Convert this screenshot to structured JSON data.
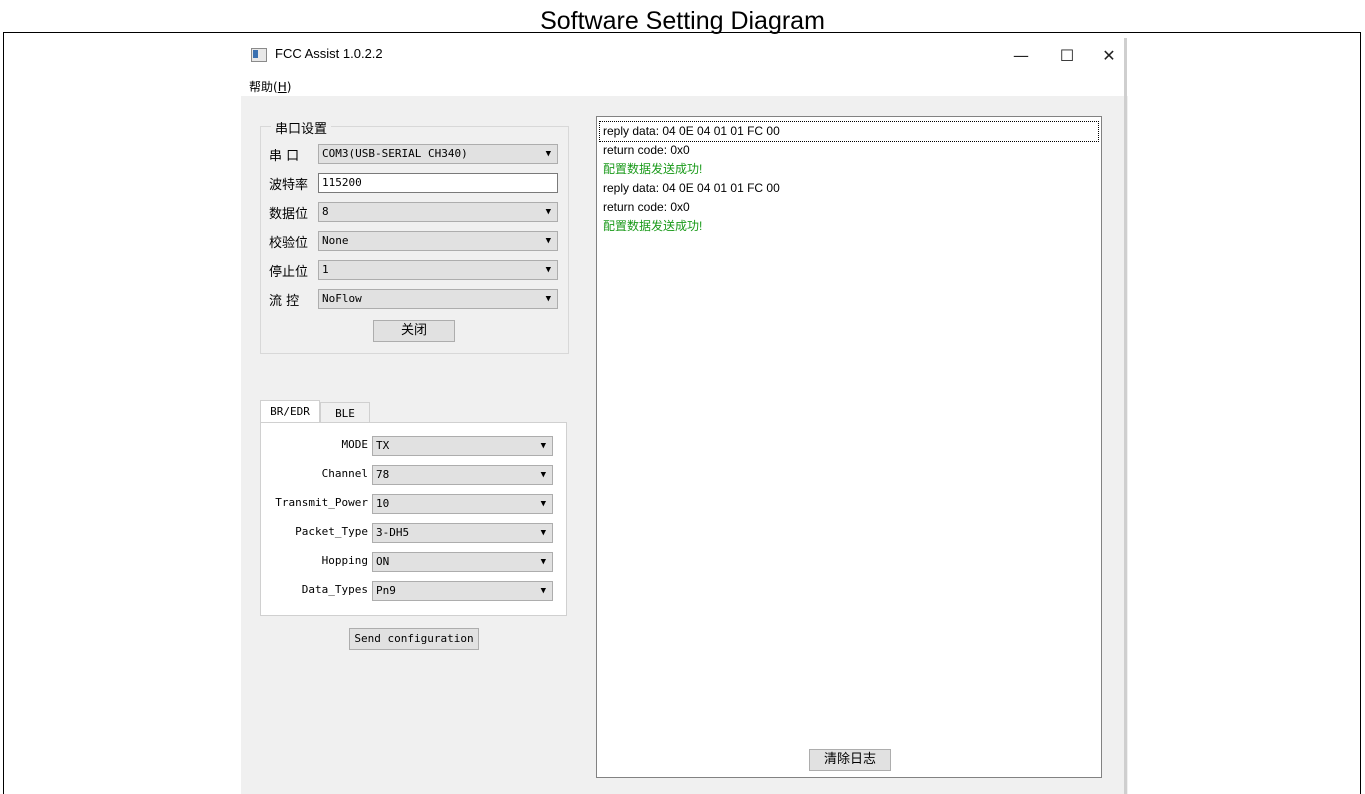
{
  "figure": {
    "title": "Software Setting Diagram"
  },
  "window": {
    "title": "FCC Assist 1.0.2.2",
    "controls": {
      "minimize": "—",
      "maximize": "☐",
      "close": "✕"
    },
    "menu": {
      "help_label": "帮助(",
      "help_key": "H",
      "help_close": ")"
    }
  },
  "serial": {
    "group_title": "串口设置",
    "port_label": "串 口",
    "port_value": "COM3(USB-SERIAL CH340)",
    "baud_label": "波特率",
    "baud_value": "115200",
    "databits_label": "数据位",
    "databits_value": "8",
    "parity_label": "校验位",
    "parity_value": "None",
    "stopbits_label": "停止位",
    "stopbits_value": "1",
    "flow_label": "流 控",
    "flow_value": "NoFlow",
    "toggle_button": "关闭"
  },
  "tabs": {
    "br_edr": "BR/EDR",
    "ble": "BLE"
  },
  "params": {
    "mode_label": "MODE",
    "mode_value": "TX",
    "channel_label": "Channel",
    "channel_value": "78",
    "power_label": "Transmit_Power",
    "power_value": "10",
    "packet_label": "Packet_Type",
    "packet_value": "3-DH5",
    "hopping_label": "Hopping",
    "hopping_value": "ON",
    "datatype_label": "Data_Types",
    "datatype_value": "Pn9"
  },
  "send_button": "Send configuration",
  "log": {
    "lines": [
      "reply data: 04 0E 04 01 01 FC 00",
      "return code: 0x0",
      "配置数据发送成功!",
      "reply data: 04 0E 04 01 01 FC 00",
      "return code: 0x0",
      "配置数据发送成功!"
    ],
    "success_color": "#1a9a1a"
  },
  "clear_button": "清除日志"
}
